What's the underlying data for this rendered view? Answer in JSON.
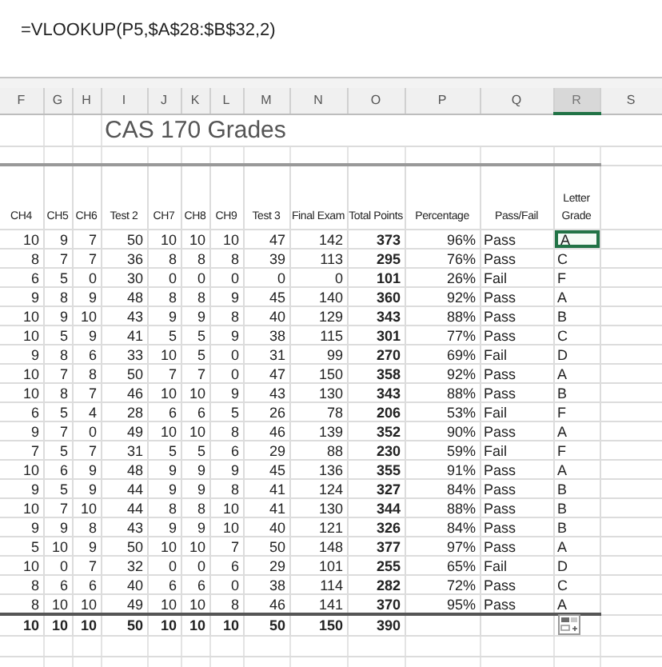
{
  "formula_bar": {
    "formula": "=VLOOKUP(P5,$A$28:$B$32,2)"
  },
  "column_letters": [
    {
      "label": "F",
      "selected": false
    },
    {
      "label": "G",
      "selected": false
    },
    {
      "label": "H",
      "selected": false
    },
    {
      "label": "I",
      "selected": false
    },
    {
      "label": "J",
      "selected": false
    },
    {
      "label": "K",
      "selected": false
    },
    {
      "label": "L",
      "selected": false
    },
    {
      "label": "M",
      "selected": false
    },
    {
      "label": "N",
      "selected": false
    },
    {
      "label": "O",
      "selected": false
    },
    {
      "label": "P",
      "selected": false
    },
    {
      "label": "Q",
      "selected": false
    },
    {
      "label": "R",
      "selected": true
    },
    {
      "label": "S",
      "selected": false
    }
  ],
  "title": "CAS 170 Grades",
  "headers": [
    "CH4",
    "CH5",
    "CH6",
    "Test 2",
    "CH7",
    "CH8",
    "CH9",
    "Test 3",
    "Final Exam",
    "Total Points",
    "Percentage",
    "Pass/Fail",
    "Letter Grade"
  ],
  "rows": [
    {
      "cells": [
        "10",
        "9",
        "7",
        "50",
        "10",
        "10",
        "10",
        "47",
        "142",
        "373",
        "96%",
        "Pass",
        "A"
      ],
      "selected": true
    },
    {
      "cells": [
        "8",
        "7",
        "7",
        "36",
        "8",
        "8",
        "8",
        "39",
        "113",
        "295",
        "76%",
        "Pass",
        "C"
      ],
      "selected": false
    },
    {
      "cells": [
        "6",
        "5",
        "0",
        "30",
        "0",
        "0",
        "0",
        "0",
        "0",
        "101",
        "26%",
        "Fail",
        "F"
      ],
      "selected": false
    },
    {
      "cells": [
        "9",
        "8",
        "9",
        "48",
        "8",
        "8",
        "9",
        "45",
        "140",
        "360",
        "92%",
        "Pass",
        "A"
      ],
      "selected": false
    },
    {
      "cells": [
        "10",
        "9",
        "10",
        "43",
        "9",
        "9",
        "8",
        "40",
        "129",
        "343",
        "88%",
        "Pass",
        "B"
      ],
      "selected": false
    },
    {
      "cells": [
        "10",
        "5",
        "9",
        "41",
        "5",
        "5",
        "9",
        "38",
        "115",
        "301",
        "77%",
        "Pass",
        "C"
      ],
      "selected": false
    },
    {
      "cells": [
        "9",
        "8",
        "6",
        "33",
        "10",
        "5",
        "0",
        "31",
        "99",
        "270",
        "69%",
        "Fail",
        "D"
      ],
      "selected": false
    },
    {
      "cells": [
        "10",
        "7",
        "8",
        "50",
        "7",
        "7",
        "0",
        "47",
        "150",
        "358",
        "92%",
        "Pass",
        "A"
      ],
      "selected": false
    },
    {
      "cells": [
        "10",
        "8",
        "7",
        "46",
        "10",
        "10",
        "9",
        "43",
        "130",
        "343",
        "88%",
        "Pass",
        "B"
      ],
      "selected": false
    },
    {
      "cells": [
        "6",
        "5",
        "4",
        "28",
        "6",
        "6",
        "5",
        "26",
        "78",
        "206",
        "53%",
        "Fail",
        "F"
      ],
      "selected": false
    },
    {
      "cells": [
        "9",
        "7",
        "0",
        "49",
        "10",
        "10",
        "8",
        "46",
        "139",
        "352",
        "90%",
        "Pass",
        "A"
      ],
      "selected": false
    },
    {
      "cells": [
        "7",
        "5",
        "7",
        "31",
        "5",
        "5",
        "6",
        "29",
        "88",
        "230",
        "59%",
        "Fail",
        "F"
      ],
      "selected": false
    },
    {
      "cells": [
        "10",
        "6",
        "9",
        "48",
        "9",
        "9",
        "9",
        "45",
        "136",
        "355",
        "91%",
        "Pass",
        "A"
      ],
      "selected": false
    },
    {
      "cells": [
        "9",
        "5",
        "9",
        "44",
        "9",
        "9",
        "8",
        "41",
        "124",
        "327",
        "84%",
        "Pass",
        "B"
      ],
      "selected": false
    },
    {
      "cells": [
        "10",
        "7",
        "10",
        "44",
        "8",
        "8",
        "10",
        "41",
        "130",
        "344",
        "88%",
        "Pass",
        "B"
      ],
      "selected": false
    },
    {
      "cells": [
        "9",
        "9",
        "8",
        "43",
        "9",
        "9",
        "10",
        "40",
        "121",
        "326",
        "84%",
        "Pass",
        "B"
      ],
      "selected": false
    },
    {
      "cells": [
        "5",
        "10",
        "9",
        "50",
        "10",
        "10",
        "7",
        "50",
        "148",
        "377",
        "97%",
        "Pass",
        "A"
      ],
      "selected": false
    },
    {
      "cells": [
        "10",
        "0",
        "7",
        "32",
        "0",
        "0",
        "6",
        "29",
        "101",
        "255",
        "65%",
        "Fail",
        "D"
      ],
      "selected": false
    },
    {
      "cells": [
        "8",
        "6",
        "6",
        "40",
        "6",
        "6",
        "0",
        "38",
        "114",
        "282",
        "72%",
        "Pass",
        "C"
      ],
      "selected": false
    },
    {
      "cells": [
        "8",
        "10",
        "10",
        "49",
        "10",
        "10",
        "8",
        "46",
        "141",
        "370",
        "95%",
        "Pass",
        "A"
      ],
      "selected": false
    }
  ],
  "totals": [
    "10",
    "10",
    "10",
    "50",
    "10",
    "10",
    "10",
    "50",
    "150",
    "390"
  ]
}
